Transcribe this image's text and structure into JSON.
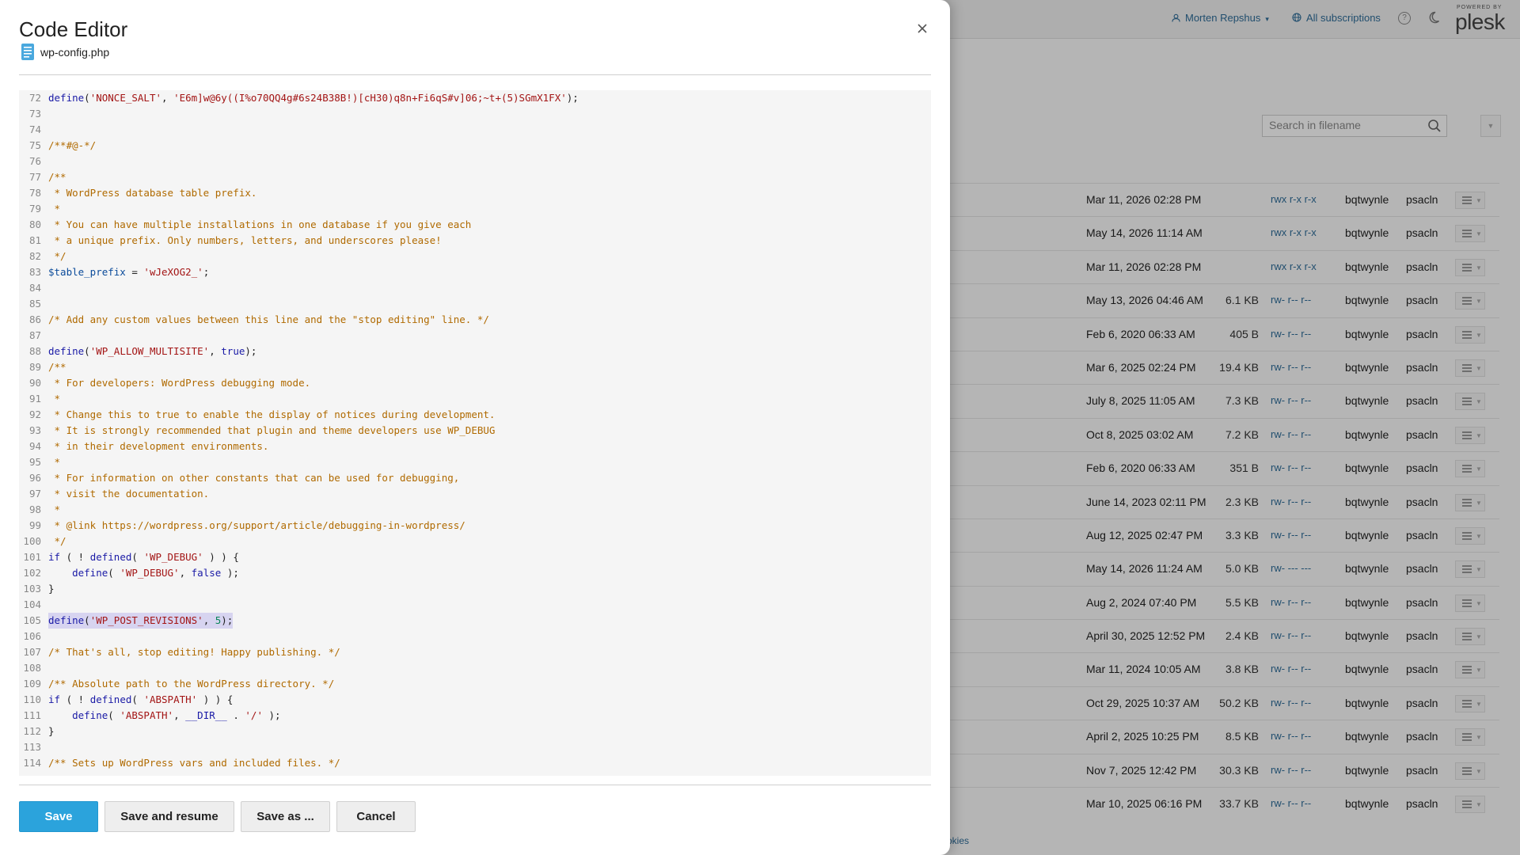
{
  "header": {
    "user": "Morten Repshus",
    "subscriptions": "All subscriptions",
    "logo_small": "POWERED BY",
    "logo_text": "plesk"
  },
  "file_manager": {
    "search_placeholder": "Search in filename",
    "rows": [
      {
        "date": "Mar 11, 2026 02:28 PM",
        "size": "",
        "perms": "rwx r-x r-x",
        "user": "bqtwynle",
        "group": "psacln"
      },
      {
        "date": "May 14, 2026 11:14 AM",
        "size": "",
        "perms": "rwx r-x r-x",
        "user": "bqtwynle",
        "group": "psacln"
      },
      {
        "date": "Mar 11, 2026 02:28 PM",
        "size": "",
        "perms": "rwx r-x r-x",
        "user": "bqtwynle",
        "group": "psacln"
      },
      {
        "date": "May 13, 2026 04:46 AM",
        "size": "6.1 KB",
        "perms": "rw- r-- r--",
        "user": "bqtwynle",
        "group": "psacln"
      },
      {
        "date": "Feb 6, 2020 06:33 AM",
        "size": "405 B",
        "perms": "rw- r-- r--",
        "user": "bqtwynle",
        "group": "psacln"
      },
      {
        "date": "Mar 6, 2025 02:24 PM",
        "size": "19.4 KB",
        "perms": "rw- r-- r--",
        "user": "bqtwynle",
        "group": "psacln"
      },
      {
        "date": "July 8, 2025 11:05 AM",
        "size": "7.3 KB",
        "perms": "rw- r-- r--",
        "user": "bqtwynle",
        "group": "psacln"
      },
      {
        "date": "Oct 8, 2025 03:02 AM",
        "size": "7.2 KB",
        "perms": "rw- r-- r--",
        "user": "bqtwynle",
        "group": "psacln"
      },
      {
        "date": "Feb 6, 2020 06:33 AM",
        "size": "351 B",
        "perms": "rw- r-- r--",
        "user": "bqtwynle",
        "group": "psacln"
      },
      {
        "date": "June 14, 2023 02:11 PM",
        "size": "2.3 KB",
        "perms": "rw- r-- r--",
        "user": "bqtwynle",
        "group": "psacln"
      },
      {
        "date": "Aug 12, 2025 02:47 PM",
        "size": "3.3 KB",
        "perms": "rw- r-- r--",
        "user": "bqtwynle",
        "group": "psacln"
      },
      {
        "date": "May 14, 2026 11:24 AM",
        "size": "5.0 KB",
        "perms": "rw- --- ---",
        "user": "bqtwynle",
        "group": "psacln"
      },
      {
        "date": "Aug 2, 2024 07:40 PM",
        "size": "5.5 KB",
        "perms": "rw- r-- r--",
        "user": "bqtwynle",
        "group": "psacln"
      },
      {
        "date": "April 30, 2025 12:52 PM",
        "size": "2.4 KB",
        "perms": "rw- r-- r--",
        "user": "bqtwynle",
        "group": "psacln"
      },
      {
        "date": "Mar 11, 2024 10:05 AM",
        "size": "3.8 KB",
        "perms": "rw- r-- r--",
        "user": "bqtwynle",
        "group": "psacln"
      },
      {
        "date": "Oct 29, 2025 10:37 AM",
        "size": "50.2 KB",
        "perms": "rw- r-- r--",
        "user": "bqtwynle",
        "group": "psacln"
      },
      {
        "date": "April 2, 2025 10:25 PM",
        "size": "8.5 KB",
        "perms": "rw- r-- r--",
        "user": "bqtwynle",
        "group": "psacln"
      },
      {
        "date": "Nov 7, 2025 12:42 PM",
        "size": "30.3 KB",
        "perms": "rw- r-- r--",
        "user": "bqtwynle",
        "group": "psacln"
      },
      {
        "date": "Mar 10, 2025 06:16 PM",
        "size": "33.7 KB",
        "perms": "rw- r-- r--",
        "user": "bqtwynle",
        "group": "psacln"
      }
    ],
    "footer_partial": "okies"
  },
  "dialog": {
    "title": "Code Editor",
    "filename": "wp-config.php",
    "buttons": {
      "save": "Save",
      "save_resume": "Save and resume",
      "save_as": "Save as ...",
      "cancel": "Cancel"
    },
    "code_lines": [
      {
        "n": "72",
        "t": [
          [
            "kw",
            "define"
          ],
          [
            "p",
            "("
          ],
          [
            "str",
            "'NONCE_SALT'"
          ],
          [
            "p",
            ", "
          ],
          [
            "str",
            "'E6m]w@6y((I%o70QQ4g#6s24B38B!)[cH30)q8n+Fi6qS#v]06;~t+(5)SGmX1FX'"
          ],
          [
            "p",
            ");"
          ]
        ]
      },
      {
        "n": "73",
        "t": []
      },
      {
        "n": "74",
        "t": []
      },
      {
        "n": "75",
        "t": [
          [
            "com",
            "/**#@-*/"
          ]
        ]
      },
      {
        "n": "76",
        "t": []
      },
      {
        "n": "77",
        "t": [
          [
            "com",
            "/**"
          ]
        ]
      },
      {
        "n": "78",
        "t": [
          [
            "com",
            " * WordPress database table prefix."
          ]
        ]
      },
      {
        "n": "79",
        "t": [
          [
            "com",
            " *"
          ]
        ]
      },
      {
        "n": "80",
        "t": [
          [
            "com",
            " * You can have multiple installations in one database if you give each"
          ]
        ]
      },
      {
        "n": "81",
        "t": [
          [
            "com",
            " * a unique prefix. Only numbers, letters, and underscores please!"
          ]
        ]
      },
      {
        "n": "82",
        "t": [
          [
            "com",
            " */"
          ]
        ]
      },
      {
        "n": "83",
        "t": [
          [
            "var",
            "$table_prefix"
          ],
          [
            "p",
            " = "
          ],
          [
            "str",
            "'wJeXOG2_'"
          ],
          [
            "p",
            ";"
          ]
        ]
      },
      {
        "n": "84",
        "t": []
      },
      {
        "n": "85",
        "t": []
      },
      {
        "n": "86",
        "t": [
          [
            "com",
            "/* Add any custom values between this line and the \"stop editing\" line. */"
          ]
        ]
      },
      {
        "n": "87",
        "t": []
      },
      {
        "n": "88",
        "t": [
          [
            "kw",
            "define"
          ],
          [
            "p",
            "("
          ],
          [
            "str",
            "'WP_ALLOW_MULTISITE'"
          ],
          [
            "p",
            ", "
          ],
          [
            "kw",
            "true"
          ],
          [
            "p",
            ");"
          ]
        ]
      },
      {
        "n": "89",
        "t": [
          [
            "com",
            "/**"
          ]
        ]
      },
      {
        "n": "90",
        "t": [
          [
            "com",
            " * For developers: WordPress debugging mode."
          ]
        ]
      },
      {
        "n": "91",
        "t": [
          [
            "com",
            " *"
          ]
        ]
      },
      {
        "n": "92",
        "t": [
          [
            "com",
            " * Change this to true to enable the display of notices during development."
          ]
        ]
      },
      {
        "n": "93",
        "t": [
          [
            "com",
            " * It is strongly recommended that plugin and theme developers use WP_DEBUG"
          ]
        ]
      },
      {
        "n": "94",
        "t": [
          [
            "com",
            " * in their development environments."
          ]
        ]
      },
      {
        "n": "95",
        "t": [
          [
            "com",
            " *"
          ]
        ]
      },
      {
        "n": "96",
        "t": [
          [
            "com",
            " * For information on other constants that can be used for debugging,"
          ]
        ]
      },
      {
        "n": "97",
        "t": [
          [
            "com",
            " * visit the documentation."
          ]
        ]
      },
      {
        "n": "98",
        "t": [
          [
            "com",
            " *"
          ]
        ]
      },
      {
        "n": "99",
        "t": [
          [
            "com",
            " * @link https://wordpress.org/support/article/debugging-in-wordpress/"
          ]
        ]
      },
      {
        "n": "100",
        "t": [
          [
            "com",
            " */"
          ]
        ]
      },
      {
        "n": "101",
        "t": [
          [
            "kw",
            "if"
          ],
          [
            "p",
            " ( ! "
          ],
          [
            "kw",
            "defined"
          ],
          [
            "p",
            "( "
          ],
          [
            "str",
            "'WP_DEBUG'"
          ],
          [
            "p",
            " ) ) {"
          ]
        ]
      },
      {
        "n": "102",
        "t": [
          [
            "p",
            "    "
          ],
          [
            "kw",
            "define"
          ],
          [
            "p",
            "( "
          ],
          [
            "str",
            "'WP_DEBUG'"
          ],
          [
            "p",
            ", "
          ],
          [
            "kw",
            "false"
          ],
          [
            "p",
            " );"
          ]
        ]
      },
      {
        "n": "103",
        "t": [
          [
            "p",
            "}"
          ]
        ]
      },
      {
        "n": "104",
        "t": []
      },
      {
        "n": "105",
        "hl": true,
        "t": [
          [
            "kw",
            "define"
          ],
          [
            "p",
            "("
          ],
          [
            "str",
            "'WP_POST_REVISIONS'"
          ],
          [
            "p",
            ", "
          ],
          [
            "num",
            "5"
          ],
          [
            "p",
            ");"
          ]
        ]
      },
      {
        "n": "106",
        "t": []
      },
      {
        "n": "107",
        "t": [
          [
            "com",
            "/* That's all, stop editing! Happy publishing. */"
          ]
        ]
      },
      {
        "n": "108",
        "t": []
      },
      {
        "n": "109",
        "t": [
          [
            "com",
            "/** Absolute path to the WordPress directory. */"
          ]
        ]
      },
      {
        "n": "110",
        "t": [
          [
            "kw",
            "if"
          ],
          [
            "p",
            " ( ! "
          ],
          [
            "kw",
            "defined"
          ],
          [
            "p",
            "( "
          ],
          [
            "str",
            "'ABSPATH'"
          ],
          [
            "p",
            " ) ) {"
          ]
        ]
      },
      {
        "n": "111",
        "t": [
          [
            "p",
            "    "
          ],
          [
            "kw",
            "define"
          ],
          [
            "p",
            "( "
          ],
          [
            "str",
            "'ABSPATH'"
          ],
          [
            "p",
            ", "
          ],
          [
            "kw",
            "__DIR__"
          ],
          [
            "p",
            " . "
          ],
          [
            "str",
            "'/'"
          ],
          [
            "p",
            " );"
          ]
        ]
      },
      {
        "n": "112",
        "t": [
          [
            "p",
            "}"
          ]
        ]
      },
      {
        "n": "113",
        "t": []
      },
      {
        "n": "114",
        "t": [
          [
            "com",
            "/** Sets up WordPress vars and included files. */"
          ]
        ]
      }
    ]
  },
  "colors": {
    "primary_button": "#2ba3dc",
    "link": "#2f6d99",
    "comment": "#b06a00",
    "string": "#a31515",
    "keyword": "#1a1aa6",
    "highlight": "#d7d4f0"
  }
}
